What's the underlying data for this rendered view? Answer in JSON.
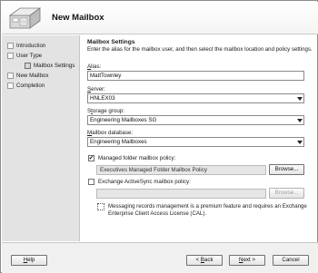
{
  "window": {
    "title": "New Mailbox",
    "wizard_icon": "mailbox-wizard-icon"
  },
  "nav": {
    "items": [
      {
        "label": "Introduction",
        "state": "done"
      },
      {
        "label": "User Type",
        "state": "done"
      },
      {
        "label": "Mailbox Settings",
        "state": "current"
      },
      {
        "label": "New Mailbox",
        "state": "pending"
      },
      {
        "label": "Completion",
        "state": "pending"
      }
    ]
  },
  "main": {
    "section_title": "Mailbox Settings",
    "intro": "Enter the alias for the mailbox user, and then select the mailbox location and policy settings.",
    "alias": {
      "label": "Alias:",
      "value": "MattTownley"
    },
    "server": {
      "label": "Server:",
      "value": "HNLEX03"
    },
    "storage_group": {
      "label": "Storage group:",
      "value": "Engineering Mailboxes SG"
    },
    "mailbox_database": {
      "label": "Mailbox database:",
      "value": "Engineering Mailboxes"
    },
    "managed_folder": {
      "label": "Managed folder mailbox policy:",
      "checked": true,
      "value": "Executives Managed Folder Mailbox Policy",
      "browse_label": "Browse..."
    },
    "activesync": {
      "label": "Exchange ActiveSync mailbox policy:",
      "checked": false,
      "value": "",
      "browse_label": "Browse..."
    },
    "note_line1": "Messaging records management is a premium feature and requires an Exchange",
    "note_line2": "Enterprise Client Access License (CAL)."
  },
  "footer": {
    "help_label": "Help",
    "back_label": "< Back",
    "next_label": "Next >",
    "cancel_label": "Cancel"
  }
}
